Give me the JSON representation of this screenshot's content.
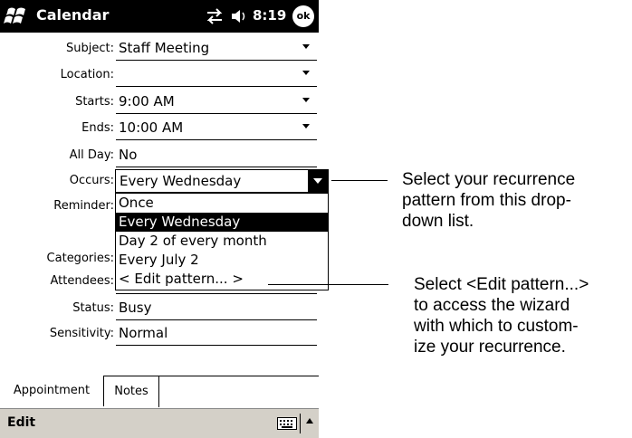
{
  "titlebar": {
    "app_title": "Calendar",
    "time": "8:19",
    "ok_label": "ok",
    "icons": [
      "windows-start-icon",
      "connectivity-icon",
      "volume-icon"
    ]
  },
  "form": {
    "subject": {
      "label": "Subject:",
      "value": "Staff Meeting"
    },
    "location": {
      "label": "Location:",
      "value": ""
    },
    "starts": {
      "label": "Starts:",
      "value": "9:00 AM"
    },
    "ends": {
      "label": "Ends:",
      "value": "10:00 AM"
    },
    "all_day": {
      "label": "All Day:",
      "value": "No"
    },
    "occurs": {
      "label": "Occurs:",
      "value": "Every Wednesday"
    },
    "reminder": {
      "label": "Reminder:"
    },
    "categories": {
      "label": "Categories:"
    },
    "attendees": {
      "label": "Attendees:"
    },
    "status": {
      "label": "Status:",
      "value": "Busy"
    },
    "sensitivity": {
      "label": "Sensitivity:",
      "value": "Normal"
    }
  },
  "occurs_options": [
    "Once",
    "Every Wednesday",
    "Day 2 of every month",
    "Every July 2",
    "< Edit pattern... >"
  ],
  "selected_option": "Every Wednesday",
  "tabs": [
    "Appointment",
    "Notes"
  ],
  "menubar": {
    "edit_label": "Edit",
    "icons": [
      "keyboard-icon",
      "sip-up-arrow-icon"
    ]
  },
  "callouts": {
    "recurrence": "Select your recurrence\npattern from this drop-\ndown list.",
    "edit_pattern": "Select <Edit pattern...>\nto access the wizard\nwith which to custom-\nize your recurrence."
  }
}
